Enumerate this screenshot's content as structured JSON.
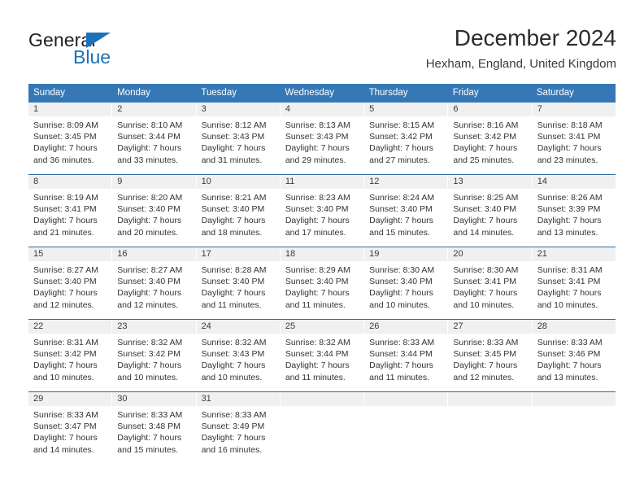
{
  "logo": {
    "text_primary": "General",
    "text_secondary": "Blue",
    "primary_color": "#231f20",
    "accent_color": "#1b72b8"
  },
  "header": {
    "title": "December 2024",
    "subtitle": "Hexham, England, United Kingdom"
  },
  "calendar": {
    "header_color": "#3578b5",
    "day_band_color": "#f0f0f0",
    "weekdays": [
      "Sunday",
      "Monday",
      "Tuesday",
      "Wednesday",
      "Thursday",
      "Friday",
      "Saturday"
    ],
    "weeks": [
      [
        {
          "day": "1",
          "lines": [
            "Sunrise: 8:09 AM",
            "Sunset: 3:45 PM",
            "Daylight: 7 hours",
            "and 36 minutes."
          ]
        },
        {
          "day": "2",
          "lines": [
            "Sunrise: 8:10 AM",
            "Sunset: 3:44 PM",
            "Daylight: 7 hours",
            "and 33 minutes."
          ]
        },
        {
          "day": "3",
          "lines": [
            "Sunrise: 8:12 AM",
            "Sunset: 3:43 PM",
            "Daylight: 7 hours",
            "and 31 minutes."
          ]
        },
        {
          "day": "4",
          "lines": [
            "Sunrise: 8:13 AM",
            "Sunset: 3:43 PM",
            "Daylight: 7 hours",
            "and 29 minutes."
          ]
        },
        {
          "day": "5",
          "lines": [
            "Sunrise: 8:15 AM",
            "Sunset: 3:42 PM",
            "Daylight: 7 hours",
            "and 27 minutes."
          ]
        },
        {
          "day": "6",
          "lines": [
            "Sunrise: 8:16 AM",
            "Sunset: 3:42 PM",
            "Daylight: 7 hours",
            "and 25 minutes."
          ]
        },
        {
          "day": "7",
          "lines": [
            "Sunrise: 8:18 AM",
            "Sunset: 3:41 PM",
            "Daylight: 7 hours",
            "and 23 minutes."
          ]
        }
      ],
      [
        {
          "day": "8",
          "lines": [
            "Sunrise: 8:19 AM",
            "Sunset: 3:41 PM",
            "Daylight: 7 hours",
            "and 21 minutes."
          ]
        },
        {
          "day": "9",
          "lines": [
            "Sunrise: 8:20 AM",
            "Sunset: 3:40 PM",
            "Daylight: 7 hours",
            "and 20 minutes."
          ]
        },
        {
          "day": "10",
          "lines": [
            "Sunrise: 8:21 AM",
            "Sunset: 3:40 PM",
            "Daylight: 7 hours",
            "and 18 minutes."
          ]
        },
        {
          "day": "11",
          "lines": [
            "Sunrise: 8:23 AM",
            "Sunset: 3:40 PM",
            "Daylight: 7 hours",
            "and 17 minutes."
          ]
        },
        {
          "day": "12",
          "lines": [
            "Sunrise: 8:24 AM",
            "Sunset: 3:40 PM",
            "Daylight: 7 hours",
            "and 15 minutes."
          ]
        },
        {
          "day": "13",
          "lines": [
            "Sunrise: 8:25 AM",
            "Sunset: 3:40 PM",
            "Daylight: 7 hours",
            "and 14 minutes."
          ]
        },
        {
          "day": "14",
          "lines": [
            "Sunrise: 8:26 AM",
            "Sunset: 3:39 PM",
            "Daylight: 7 hours",
            "and 13 minutes."
          ]
        }
      ],
      [
        {
          "day": "15",
          "lines": [
            "Sunrise: 8:27 AM",
            "Sunset: 3:40 PM",
            "Daylight: 7 hours",
            "and 12 minutes."
          ]
        },
        {
          "day": "16",
          "lines": [
            "Sunrise: 8:27 AM",
            "Sunset: 3:40 PM",
            "Daylight: 7 hours",
            "and 12 minutes."
          ]
        },
        {
          "day": "17",
          "lines": [
            "Sunrise: 8:28 AM",
            "Sunset: 3:40 PM",
            "Daylight: 7 hours",
            "and 11 minutes."
          ]
        },
        {
          "day": "18",
          "lines": [
            "Sunrise: 8:29 AM",
            "Sunset: 3:40 PM",
            "Daylight: 7 hours",
            "and 11 minutes."
          ]
        },
        {
          "day": "19",
          "lines": [
            "Sunrise: 8:30 AM",
            "Sunset: 3:40 PM",
            "Daylight: 7 hours",
            "and 10 minutes."
          ]
        },
        {
          "day": "20",
          "lines": [
            "Sunrise: 8:30 AM",
            "Sunset: 3:41 PM",
            "Daylight: 7 hours",
            "and 10 minutes."
          ]
        },
        {
          "day": "21",
          "lines": [
            "Sunrise: 8:31 AM",
            "Sunset: 3:41 PM",
            "Daylight: 7 hours",
            "and 10 minutes."
          ]
        }
      ],
      [
        {
          "day": "22",
          "lines": [
            "Sunrise: 8:31 AM",
            "Sunset: 3:42 PM",
            "Daylight: 7 hours",
            "and 10 minutes."
          ]
        },
        {
          "day": "23",
          "lines": [
            "Sunrise: 8:32 AM",
            "Sunset: 3:42 PM",
            "Daylight: 7 hours",
            "and 10 minutes."
          ]
        },
        {
          "day": "24",
          "lines": [
            "Sunrise: 8:32 AM",
            "Sunset: 3:43 PM",
            "Daylight: 7 hours",
            "and 10 minutes."
          ]
        },
        {
          "day": "25",
          "lines": [
            "Sunrise: 8:32 AM",
            "Sunset: 3:44 PM",
            "Daylight: 7 hours",
            "and 11 minutes."
          ]
        },
        {
          "day": "26",
          "lines": [
            "Sunrise: 8:33 AM",
            "Sunset: 3:44 PM",
            "Daylight: 7 hours",
            "and 11 minutes."
          ]
        },
        {
          "day": "27",
          "lines": [
            "Sunrise: 8:33 AM",
            "Sunset: 3:45 PM",
            "Daylight: 7 hours",
            "and 12 minutes."
          ]
        },
        {
          "day": "28",
          "lines": [
            "Sunrise: 8:33 AM",
            "Sunset: 3:46 PM",
            "Daylight: 7 hours",
            "and 13 minutes."
          ]
        }
      ],
      [
        {
          "day": "29",
          "lines": [
            "Sunrise: 8:33 AM",
            "Sunset: 3:47 PM",
            "Daylight: 7 hours",
            "and 14 minutes."
          ]
        },
        {
          "day": "30",
          "lines": [
            "Sunrise: 8:33 AM",
            "Sunset: 3:48 PM",
            "Daylight: 7 hours",
            "and 15 minutes."
          ]
        },
        {
          "day": "31",
          "lines": [
            "Sunrise: 8:33 AM",
            "Sunset: 3:49 PM",
            "Daylight: 7 hours",
            "and 16 minutes."
          ]
        },
        {
          "day": "",
          "lines": []
        },
        {
          "day": "",
          "lines": []
        },
        {
          "day": "",
          "lines": []
        },
        {
          "day": "",
          "lines": []
        }
      ]
    ]
  }
}
